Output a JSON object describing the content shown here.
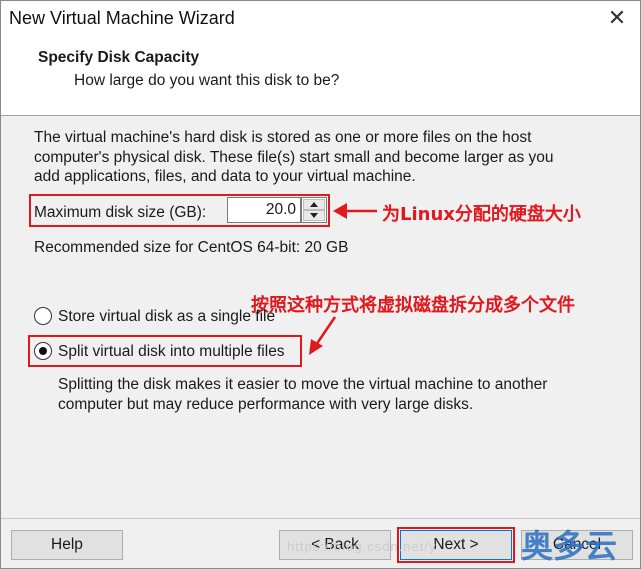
{
  "window": {
    "title": "New Virtual Machine Wizard",
    "close_glyph": "✕"
  },
  "header": {
    "title": "Specify Disk Capacity",
    "subtitle": "How large do you want this disk to be?"
  },
  "intro": {
    "line1": "The virtual machine's hard disk is stored as one or more files on the host",
    "line2": "computer's physical disk. These file(s) start small and become larger as you",
    "line3": "add applications, files, and data to your virtual machine."
  },
  "disk_size": {
    "label": "Maximum disk size (GB):",
    "value": "20.0",
    "recommended": "Recommended size for CentOS 64-bit: 20 GB"
  },
  "annotations": {
    "disk_size_note": "为Linux分配的硬盘大小",
    "split_note": "按照这种方式将虚拟磁盘拆分成多个文件"
  },
  "options": {
    "single": {
      "label": "Store virtual disk as a single file",
      "selected": false
    },
    "split": {
      "label": "Split virtual disk into multiple files",
      "selected": true
    },
    "split_desc_line1": "Splitting the disk makes it easier to move the virtual machine to another",
    "split_desc_line2": "computer but may reduce performance with very large disks."
  },
  "buttons": {
    "help": "Help",
    "back": "< Back",
    "next": "Next >",
    "cancel": "Cancel"
  },
  "watermark": {
    "text": "https://blog.csdn.net/y",
    "logo": "奥多云"
  },
  "colors": {
    "annotation_red": "#e0191e",
    "header_bg": "#ffffff",
    "dialog_bg": "#f0f0f0",
    "logo_blue": "#2a6fc4"
  }
}
